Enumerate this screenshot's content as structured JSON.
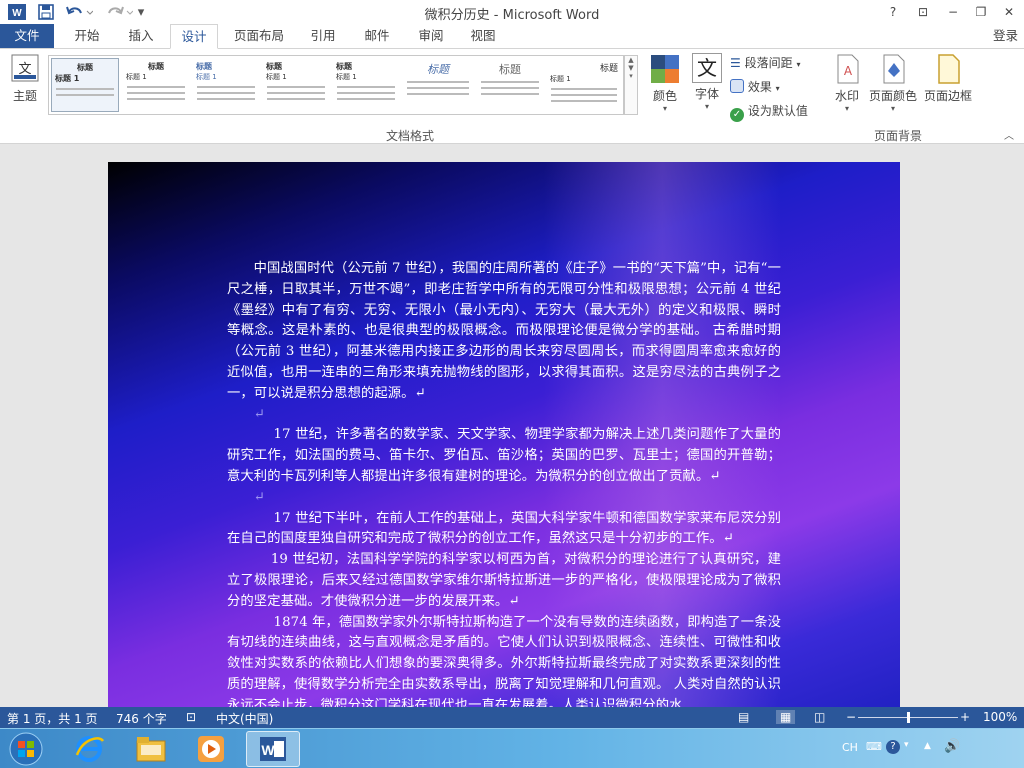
{
  "window": {
    "title": "微积分历史 - Microsoft Word",
    "help": "?",
    "restore_ribbon": "⊡",
    "minimize": "−",
    "maximize": "❐",
    "close": "✕"
  },
  "quick_access": {
    "word_icon": "word-app-icon",
    "save_icon": "save-icon",
    "undo_icon": "undo-icon",
    "redo_icon": "redo-icon",
    "customize_icon": "customize-icon"
  },
  "tabs": [
    {
      "label": "文件"
    },
    {
      "label": "开始"
    },
    {
      "label": "插入"
    },
    {
      "label": "设计"
    },
    {
      "label": "页面布局"
    },
    {
      "label": "引用"
    },
    {
      "label": "邮件"
    },
    {
      "label": "审阅"
    },
    {
      "label": "视图"
    }
  ],
  "account": "登录",
  "ribbon": {
    "theme": "主题",
    "gallery_group_name": "文档格式",
    "gallery": [
      {
        "heading": "标题",
        "sub": "标题 1"
      },
      {
        "heading": "标题",
        "sub": "标题 1"
      },
      {
        "heading": "标题",
        "sub": "标题 1"
      },
      {
        "heading": "标题",
        "sub": "标题 1"
      },
      {
        "heading": "标题",
        "sub": "标题 1"
      },
      {
        "heading": "标题",
        "sub": ""
      },
      {
        "heading": "标题",
        "sub": ""
      },
      {
        "heading": "标题",
        "sub": "标题 1"
      }
    ],
    "colors": "颜色",
    "fonts": "字体",
    "font_glyph": "文",
    "paragraph_spacing": "段落间距",
    "effects": "效果",
    "set_default": "设为默认值",
    "watermark": "水印",
    "page_color": "页面颜色",
    "page_border": "页面边框",
    "page_bg_group_name": "页面背景"
  },
  "document": {
    "paragraphs": [
      "中国战国时代（公元前 7 世纪），我国的庄周所著的《庄子》一书的“天下篇”中，记有“一尺之棰，日取其半，万世不竭”，即老庄哲学中所有的无限可分性和极限思想；公元前 4 世纪《墨经》中有了有穷、无穷、无限小（最小无内）、无穷大（最大无外）的定义和极限、瞬时等概念。这是朴素的、也是很典型的极限概念。而极限理论便是微分学的基础。    古希腊时期（公元前 3 世纪），阿基米德用内接正多边形的周长来穷尽圆周长，而求得圆周率愈来愈好的近似值，也用一连串的三角形来填充抛物线的图形，以求得其面积。这是穷尽法的古典例子之一，可以说是积分思想的起源。↵",
      "↵",
      "17 世纪，许多著名的数学家、天文学家、物理学家都为解决上述几类问题作了大量的研究工作，如法国的费马、笛卡尔、罗伯瓦、笛沙格；英国的巴罗、瓦里士；德国的开普勒；意大利的卡瓦列利等人都提出许多很有建树的理论。为微积分的创立做出了贡献。↵",
      "↵",
      "17 世纪下半叶，在前人工作的基础上，英国大科学家牛顿和德国数学家莱布尼茨分别在自己的国度里独自研究和完成了微积分的创立工作，虽然这只是十分初步的工作。↵",
      "19 世纪初，法国科学学院的科学家以柯西为首，对微积分的理论进行了认真研究，建立了极限理论，后来又经过德国数学家维尔斯特拉斯进一步的严格化，使极限理论成为了微积分的坚定基础。才使微积分进一步的发展开来。↵",
      "1874 年，德国数学家外尔斯特拉斯构造了一个没有导数的连续函数，即构造了一条没有切线的连续曲线，这与直观概念是矛盾的。它使人们认识到极限概念、连续性、可微性和收敛性对实数系的依赖比人们想象的要深奥得多。外尔斯特拉斯最终完成了对实数系更深刻的性质的理解，使得数学分析完全由实数系导出，脱离了知觉理解和几何直观。    人类对自然的认识永远不会止步，微积分这门学科在现代也一直在发展着。人类认识微积分的水"
    ]
  },
  "status": {
    "page": "第 1 页，共 1 页",
    "words": "746 个字",
    "language": "中文(中国)",
    "zoom": "100%",
    "zoom_level": 0.5
  },
  "taskbar": {
    "items": [
      "start-orb",
      "internet-explorer",
      "file-explorer",
      "media-player",
      "microsoft-word"
    ],
    "tray_lang": "CH",
    "tray_up": "▲"
  }
}
